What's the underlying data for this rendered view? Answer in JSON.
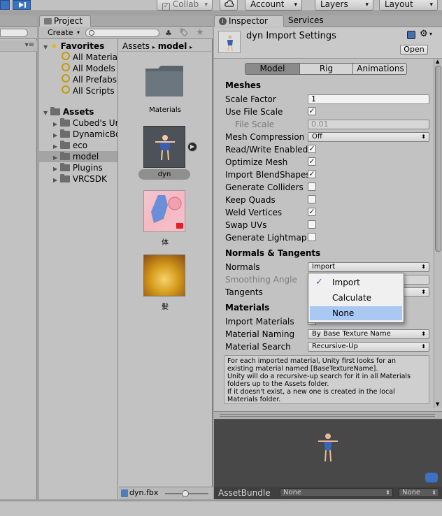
{
  "toolbar": {
    "collab_label": "Collab",
    "account_label": "Account",
    "layers_label": "Layers",
    "layout_label": "Layout"
  },
  "project": {
    "tab_label": "Project",
    "create_label": "Create",
    "favorites": {
      "label": "Favorites",
      "items": [
        "All Materials",
        "All Models",
        "All Prefabs",
        "All Scripts"
      ]
    },
    "assets": {
      "label": "Assets",
      "folders": [
        "Cubed's Ur",
        "DynamicBo",
        "eco",
        "model",
        "Plugins",
        "VRCSDK"
      ]
    },
    "breadcrumb": {
      "root": "Assets",
      "current": "model"
    },
    "grid_items": [
      {
        "label": "Materials"
      },
      {
        "label": "dyn"
      },
      {
        "label": "体"
      },
      {
        "label": "髪"
      }
    ],
    "footer_file": "dyn.fbx"
  },
  "inspector": {
    "tab_label": "Inspector",
    "services_label": "Services",
    "title": "dyn Import Settings",
    "open_label": "Open",
    "tabs": [
      "Model",
      "Rig",
      "Animations"
    ],
    "meshes": {
      "heading": "Meshes",
      "scale_factor_label": "Scale Factor",
      "scale_factor_value": "1",
      "use_file_scale_label": "Use File Scale",
      "file_scale_label": "File Scale",
      "file_scale_value": "0.01",
      "mesh_compression_label": "Mesh Compression",
      "mesh_compression_value": "Off",
      "read_write_label": "Read/Write Enabled",
      "optimize_mesh_label": "Optimize Mesh",
      "import_blendshapes_label": "Import BlendShapes",
      "generate_colliders_label": "Generate Colliders",
      "keep_quads_label": "Keep Quads",
      "weld_vertices_label": "Weld Vertices",
      "swap_uvs_label": "Swap UVs",
      "generate_lightmap_label": "Generate Lightmap U"
    },
    "normals": {
      "heading": "Normals & Tangents",
      "normals_label": "Normals",
      "normals_value": "Import",
      "smoothing_label": "Smoothing Angle",
      "tangents_label": "Tangents"
    },
    "materials": {
      "heading": "Materials",
      "import_materials_label": "Import Materials",
      "naming_label": "Material Naming",
      "naming_value": "By Base Texture Name",
      "search_label": "Material Search",
      "search_value": "Recursive-Up",
      "help_lines": [
        "For each imported material, Unity first looks for an",
        "existing material named [BaseTextureName].",
        "Unity will do a recursive-up search for it in all Materials",
        "folders up to the Assets folder.",
        "If it doesn't exist, a new one is created in the local",
        "Materials folder."
      ]
    },
    "popup": {
      "items": [
        "Import",
        "Calculate",
        "None"
      ],
      "checked": "Import",
      "highlighted": "None"
    },
    "asset_bundle": {
      "label": "AssetBundle",
      "name_value": "None",
      "variant_value": "None"
    }
  },
  "colors": {
    "panel_bg": "#c2c2c2",
    "highlight": "#a9c9f2",
    "accent_blue": "#3a72c4"
  }
}
